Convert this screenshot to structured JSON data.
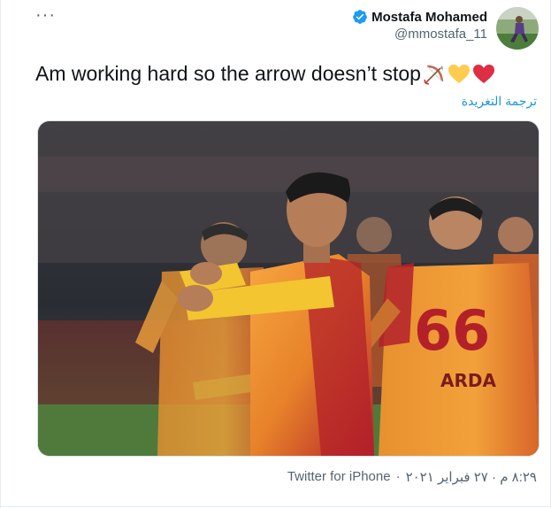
{
  "tweet": {
    "display_name": "Mostafa Mohamed",
    "handle": "@mmostafa_11",
    "text": "Am working hard so the arrow doesn’t stop",
    "emoji_icons": [
      "bow-and-arrow-icon",
      "yellow-heart-icon",
      "red-heart-icon"
    ],
    "translate_label": "ترجمة التغريدة",
    "timestamp": "٨:٢٩ م · ٢٧ فبراير ٢٠٢١",
    "source_separator": " · ",
    "source": "Twitter for iPhone",
    "more_label": "···"
  },
  "photo": {
    "jersey_number": "66",
    "jersey_name": "ARDA"
  },
  "colors": {
    "link": "#1b95e0",
    "verified": "#1d9bf0",
    "jersey_orange": "#f2a13a",
    "jersey_red": "#b3202a"
  }
}
